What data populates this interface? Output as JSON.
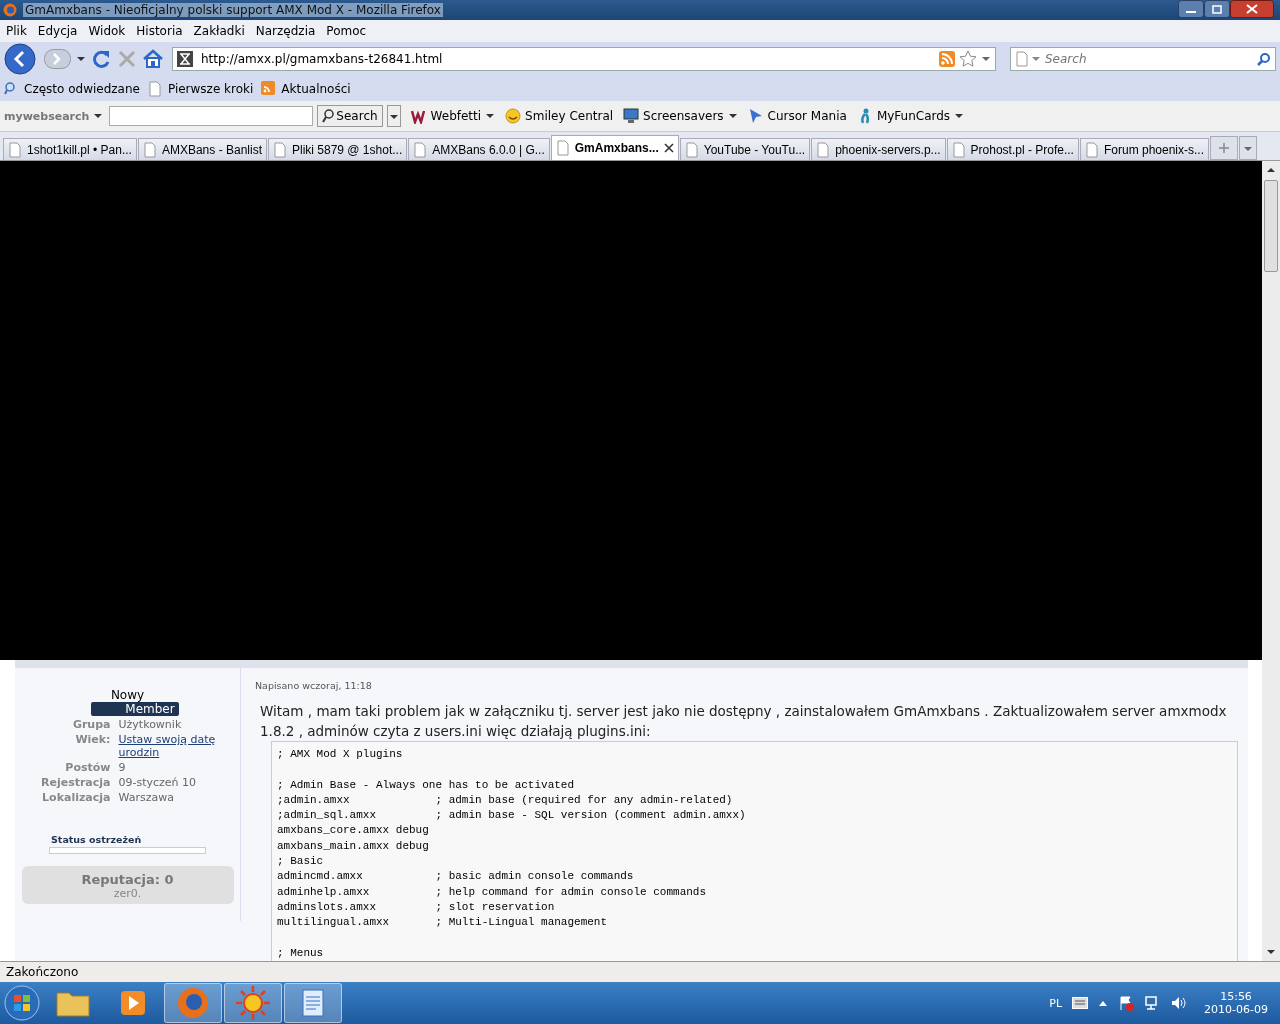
{
  "window": {
    "title": "GmAmxbans - Nieoficjalny polski support AMX Mod X - Mozilla Firefox"
  },
  "menu": [
    "Plik",
    "Edycja",
    "Widok",
    "Historia",
    "Zakładki",
    "Narzędzia",
    "Pomoc"
  ],
  "address": {
    "value": "http://amxx.pl/gmamxbans-t26841.html"
  },
  "search": {
    "placeholder": "Search"
  },
  "bookmarks": [
    "Często odwiedzane",
    "Pierwsze kroki",
    "Aktualności"
  ],
  "toolbar": {
    "brand": "mywebsearch",
    "button": "Search",
    "items": [
      "Webfetti",
      "Smiley Central",
      "Screensavers",
      "Cursor Mania",
      "MyFunCards"
    ]
  },
  "tabs": [
    {
      "label": "1shot1kill.pl • Pan...",
      "selected": false
    },
    {
      "label": "AMXBans - Banlist",
      "selected": false
    },
    {
      "label": "Pliki 5879 @ 1shot...",
      "selected": false
    },
    {
      "label": "AMXBans 6.0.0 | G...",
      "selected": false
    },
    {
      "label": "GmAmxbans...",
      "selected": true
    },
    {
      "label": "YouTube - YouTu...",
      "selected": false
    },
    {
      "label": "phoenix-servers.p...",
      "selected": false
    },
    {
      "label": "Prohost.pl - Profe...",
      "selected": false
    },
    {
      "label": "Forum phoenix-s...",
      "selected": false
    }
  ],
  "post": {
    "rank": "Nowy",
    "badge": "Member",
    "fields": [
      {
        "label": "Grupa",
        "value": "Użytkownik",
        "kind": "text"
      },
      {
        "label": "Wiek:",
        "value": "Ustaw swoją datę urodzin",
        "kind": "link"
      },
      {
        "label": "Postów",
        "value": "9",
        "kind": "text"
      },
      {
        "label": "Rejestracja",
        "value": "09-styczeń 10",
        "kind": "text"
      },
      {
        "label": "Lokalizacja",
        "value": "Warszawa",
        "kind": "text"
      }
    ],
    "warn_label": "Status ostrzeżeń",
    "warn": {
      "level": 0
    },
    "reputation": "Reputacja: 0",
    "rep_note": "zer0.",
    "date": "Napisano wczoraj, 11:18",
    "text": "Witam , mam taki problem jak w załączniku tj. server jest jako nie dostępny , zainstalowałem GmAmxbans . Zaktualizowałem server amxmodx 1.8.2 , adminów czyta z users.ini więc działają plugins.ini:",
    "code": "; AMX Mod X plugins\n\n; Admin Base - Always one has to be activated\n;admin.amxx             ; admin base (required for any admin-related)\n;admin_sql.amxx         ; admin base - SQL version (comment admin.amxx)\namxbans_core.amxx debug\namxbans_main.amxx debug\n; Basic\nadmincmd.amxx           ; basic admin console commands\nadminhelp.amxx          ; help command for admin console commands\nadminslots.amxx         ; slot reservation\nmultilingual.amxx       ; Multi-Lingual management\n\n; Menus"
  },
  "status_bar": "Zakończono",
  "taskbar": {
    "lang": "PL",
    "time": "15:56",
    "date": "2010-06-09"
  }
}
